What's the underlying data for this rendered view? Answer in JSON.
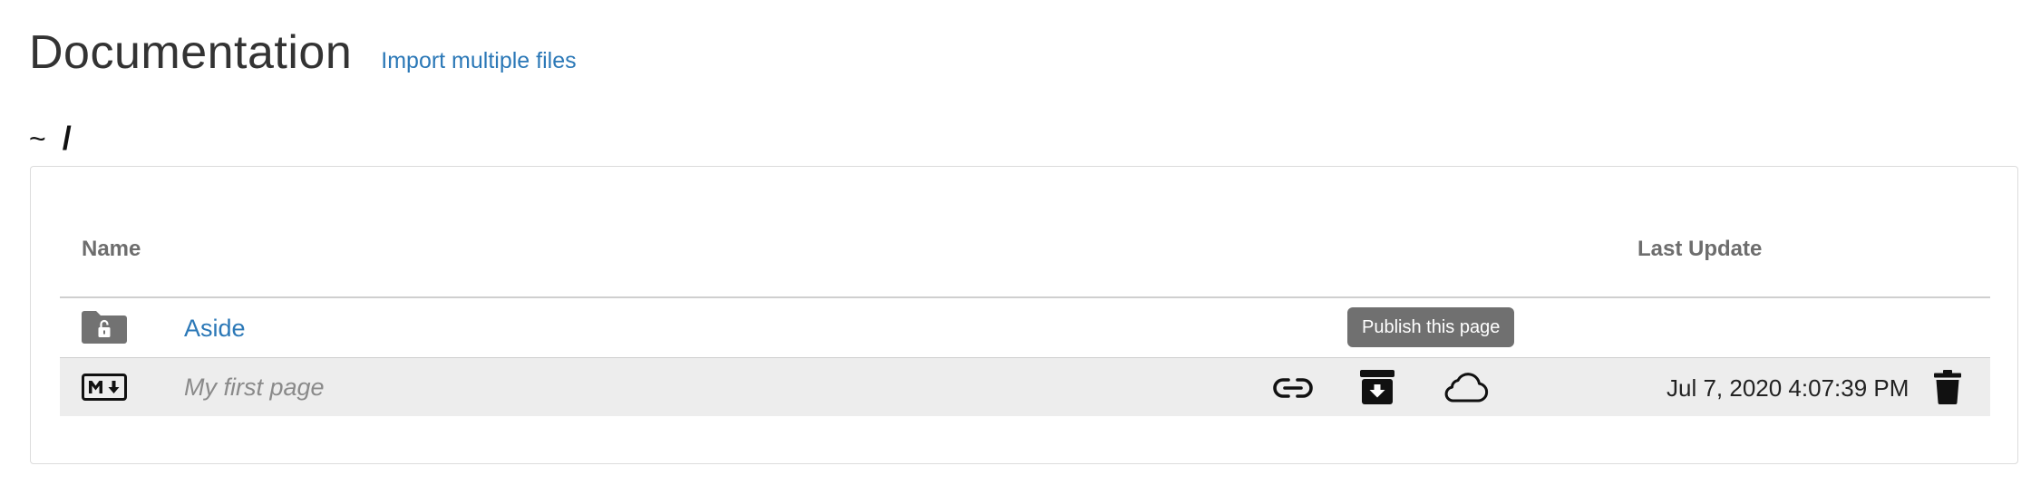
{
  "header": {
    "title": "Documentation",
    "import_link": "Import multiple files"
  },
  "breadcrumb": {
    "home": "~",
    "separator": "/"
  },
  "table": {
    "columns": {
      "name": "Name",
      "last_update": "Last Update"
    },
    "rows": [
      {
        "type": "folder",
        "icon": "locked-folder-icon",
        "name": "Aside",
        "last_update": ""
      },
      {
        "type": "page",
        "icon": "markdown-icon",
        "name": "My first page",
        "last_update": "Jul 7, 2020 4:07:39 PM",
        "actions": [
          "link-icon",
          "archive-download-icon",
          "cloud-icon",
          "trash-icon"
        ]
      }
    ]
  },
  "tooltip": {
    "text": "Publish this page"
  },
  "colors": {
    "link": "#2b78b7",
    "header_text": "#6d6d6d",
    "row_highlight": "#ededed",
    "tooltip_bg": "#707070"
  }
}
